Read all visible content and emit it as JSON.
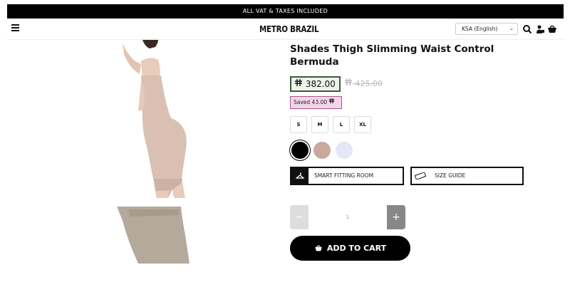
{
  "announcement": "ALL VAT & TAXES INCLUDED",
  "header": {
    "logo": "METRO BRAZIL",
    "language": "KSA (English)",
    "icons": [
      "menu-icon",
      "search-icon",
      "account-icon",
      "cart-icon"
    ]
  },
  "product": {
    "title": "Shades Thigh Slimming Waist Control Bermuda",
    "price": "382.00",
    "old_price": "425.00",
    "saved": "Saved 43.00",
    "currency_icon": "riyal-icon",
    "sizes": [
      "S",
      "M",
      "L",
      "XL"
    ],
    "colors": [
      "#000000",
      "#c9a89e",
      "#e6e6f6"
    ],
    "fitting_room": "SMART FITTING ROOM",
    "size_guide": "SIZE GUIDE",
    "quantity": "1",
    "qty_minus": "−",
    "qty_plus": "+",
    "add_to_cart": "ADD TO CART"
  }
}
